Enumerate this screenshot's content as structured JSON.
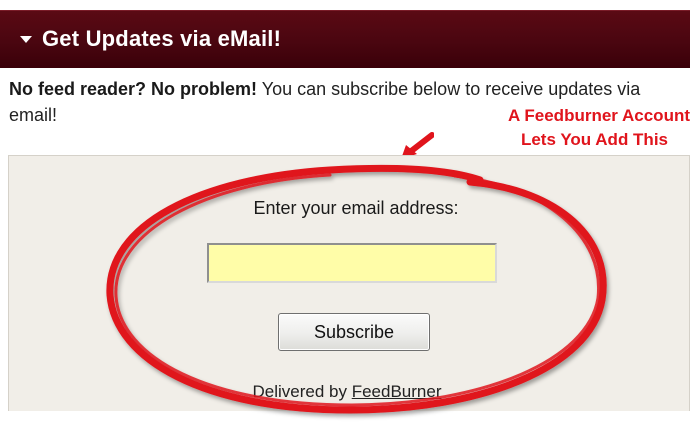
{
  "header": {
    "title": "Get Updates via eMail!",
    "background_color": "#4a0610"
  },
  "intro": {
    "bold": "No feed reader? No problem!",
    "rest": " You can subscribe below to receive updates via email!"
  },
  "annotation": {
    "line1": "A Feedburner Account",
    "line2": "Lets You Add This",
    "color": "#e0141c"
  },
  "form": {
    "prompt": "Enter your email address:",
    "email_value": "",
    "input_color": "#fffda8",
    "subscribe_label": "Subscribe"
  },
  "footer": {
    "delivered_by": "Delivered by",
    "link_label": "FeedBurner"
  }
}
